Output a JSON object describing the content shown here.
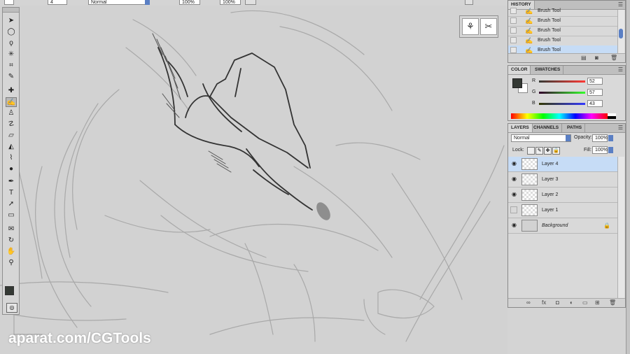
{
  "options_bar": {
    "brush_size": "4",
    "mode_value": "Normal",
    "opacity_value": "100%",
    "flow_value": "100%"
  },
  "toolbox": {
    "tools": [
      {
        "name": "move-tool-icon",
        "glyph": "➤"
      },
      {
        "name": "marquee-tool-icon",
        "glyph": "◯"
      },
      {
        "name": "lasso-tool-icon",
        "glyph": "ϙ"
      },
      {
        "name": "magic-wand-tool-icon",
        "glyph": "✳"
      },
      {
        "name": "crop-tool-icon",
        "glyph": "⌗"
      },
      {
        "name": "eyedropper-tool-icon",
        "glyph": "✎"
      },
      {
        "name": "healing-brush-tool-icon",
        "glyph": "✚"
      },
      {
        "name": "brush-tool-icon",
        "glyph": "✍"
      },
      {
        "name": "clone-stamp-tool-icon",
        "glyph": "♙"
      },
      {
        "name": "history-brush-tool-icon",
        "glyph": "☡"
      },
      {
        "name": "eraser-tool-icon",
        "glyph": "▱"
      },
      {
        "name": "paint-bucket-tool-icon",
        "glyph": "◭"
      },
      {
        "name": "blur-tool-icon",
        "glyph": "⌇"
      },
      {
        "name": "dodge-tool-icon",
        "glyph": "●"
      },
      {
        "name": "pen-tool-icon",
        "glyph": "✒"
      },
      {
        "name": "type-tool-icon",
        "glyph": "T"
      },
      {
        "name": "path-selection-tool-icon",
        "glyph": "➚"
      },
      {
        "name": "rectangle-tool-icon",
        "glyph": "▭"
      },
      {
        "name": "notes-tool-icon",
        "glyph": "✉"
      },
      {
        "name": "rotate-view-tool-icon",
        "glyph": "↻"
      },
      {
        "name": "hand-tool-icon",
        "glyph": "✋"
      },
      {
        "name": "zoom-tool-icon",
        "glyph": "⚲"
      }
    ],
    "colors": {
      "foreground": "#343934",
      "background": "#ffffff"
    }
  },
  "history": {
    "tab": "HISTORY",
    "items": [
      {
        "label": "Brush Tool"
      },
      {
        "label": "Brush Tool"
      },
      {
        "label": "Brush Tool"
      },
      {
        "label": "Brush Tool"
      },
      {
        "label": "Brush Tool"
      }
    ]
  },
  "color_panel": {
    "tabs": [
      "COLOR",
      "SWATCHES"
    ],
    "channels": [
      {
        "label": "R",
        "value": "52"
      },
      {
        "label": "G",
        "value": "57"
      },
      {
        "label": "B",
        "value": "43"
      }
    ],
    "foreground": "#343934"
  },
  "layers_panel": {
    "tabs": [
      "LAYERS",
      "CHANNELS",
      "PATHS"
    ],
    "blend_mode": "Normal",
    "opacity_label": "Opacity:",
    "opacity_value": "100%",
    "lock_label": "Lock:",
    "fill_label": "Fill:",
    "fill_value": "100%",
    "layers": [
      {
        "name": "Layer 4",
        "visible": true,
        "selected": true
      },
      {
        "name": "Layer 3",
        "visible": true,
        "selected": false
      },
      {
        "name": "Layer 2",
        "visible": true,
        "selected": false
      },
      {
        "name": "Layer 1",
        "visible": false,
        "selected": false
      },
      {
        "name": "Background",
        "visible": true,
        "selected": false
      }
    ]
  },
  "watermark": "aparat.com/CGTools"
}
